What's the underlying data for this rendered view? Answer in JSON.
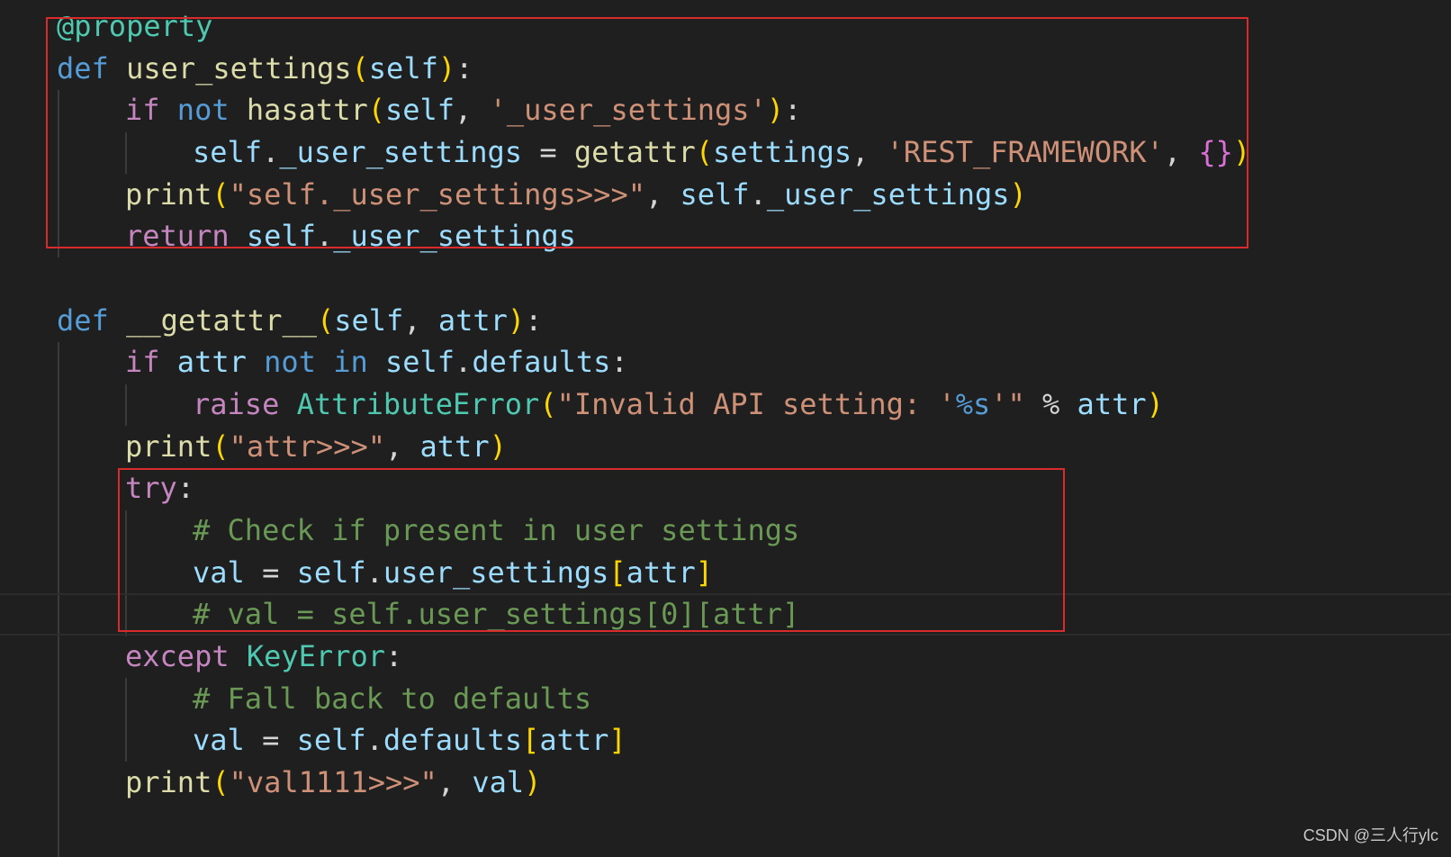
{
  "editor": {
    "lines": [
      {
        "tokens": [
          {
            "t": "@property",
            "c": "cls"
          }
        ]
      },
      {
        "tokens": [
          {
            "t": "def ",
            "c": "kw"
          },
          {
            "t": "user_settings",
            "c": "fn"
          },
          {
            "t": "(",
            "c": "br1"
          },
          {
            "t": "self",
            "c": "var"
          },
          {
            "t": ")",
            "c": "br1"
          },
          {
            "t": ":",
            "c": "op"
          }
        ]
      },
      {
        "tokens": [
          {
            "t": "if ",
            "c": "ctrl"
          },
          {
            "t": "not ",
            "c": "kw"
          },
          {
            "t": "hasattr",
            "c": "fn"
          },
          {
            "t": "(",
            "c": "br1"
          },
          {
            "t": "self",
            "c": "var"
          },
          {
            "t": ", ",
            "c": "op"
          },
          {
            "t": "'_user_settings'",
            "c": "str"
          },
          {
            "t": ")",
            "c": "br1"
          },
          {
            "t": ":",
            "c": "op"
          }
        ]
      },
      {
        "tokens": [
          {
            "t": "self",
            "c": "var"
          },
          {
            "t": ".",
            "c": "op"
          },
          {
            "t": "_user_settings",
            "c": "var"
          },
          {
            "t": " = ",
            "c": "op"
          },
          {
            "t": "getattr",
            "c": "fn"
          },
          {
            "t": "(",
            "c": "br1"
          },
          {
            "t": "settings",
            "c": "var"
          },
          {
            "t": ", ",
            "c": "op"
          },
          {
            "t": "'REST_FRAMEWORK'",
            "c": "str"
          },
          {
            "t": ", ",
            "c": "op"
          },
          {
            "t": "{}",
            "c": "br2"
          },
          {
            "t": ")",
            "c": "br1"
          }
        ]
      },
      {
        "tokens": [
          {
            "t": "print",
            "c": "fn"
          },
          {
            "t": "(",
            "c": "br1"
          },
          {
            "t": "\"self._user_settings>>>\"",
            "c": "str"
          },
          {
            "t": ", ",
            "c": "op"
          },
          {
            "t": "self",
            "c": "var"
          },
          {
            "t": ".",
            "c": "op"
          },
          {
            "t": "_user_settings",
            "c": "var"
          },
          {
            "t": ")",
            "c": "br1"
          }
        ]
      },
      {
        "tokens": [
          {
            "t": "return ",
            "c": "ctrl"
          },
          {
            "t": "self",
            "c": "var"
          },
          {
            "t": ".",
            "c": "op"
          },
          {
            "t": "_user_settings",
            "c": "var"
          }
        ]
      },
      {
        "tokens": [
          {
            "t": "def ",
            "c": "kw"
          },
          {
            "t": "__getattr__",
            "c": "fn"
          },
          {
            "t": "(",
            "c": "br1"
          },
          {
            "t": "self",
            "c": "var"
          },
          {
            "t": ", ",
            "c": "op"
          },
          {
            "t": "attr",
            "c": "var"
          },
          {
            "t": ")",
            "c": "br1"
          },
          {
            "t": ":",
            "c": "op"
          }
        ]
      },
      {
        "tokens": [
          {
            "t": "if ",
            "c": "ctrl"
          },
          {
            "t": "attr ",
            "c": "var"
          },
          {
            "t": "not ",
            "c": "kw"
          },
          {
            "t": "in ",
            "c": "kw"
          },
          {
            "t": "self",
            "c": "var"
          },
          {
            "t": ".",
            "c": "op"
          },
          {
            "t": "defaults",
            "c": "var"
          },
          {
            "t": ":",
            "c": "op"
          }
        ]
      },
      {
        "tokens": [
          {
            "t": "raise ",
            "c": "ctrl"
          },
          {
            "t": "AttributeError",
            "c": "cls"
          },
          {
            "t": "(",
            "c": "br1"
          },
          {
            "t": "\"Invalid API setting: '",
            "c": "str"
          },
          {
            "t": "%s",
            "c": "fmt"
          },
          {
            "t": "'\"",
            "c": "str"
          },
          {
            "t": " % ",
            "c": "op"
          },
          {
            "t": "attr",
            "c": "var"
          },
          {
            "t": ")",
            "c": "br1"
          }
        ]
      },
      {
        "tokens": [
          {
            "t": "print",
            "c": "fn"
          },
          {
            "t": "(",
            "c": "br1"
          },
          {
            "t": "\"attr>>>\"",
            "c": "str"
          },
          {
            "t": ", ",
            "c": "op"
          },
          {
            "t": "attr",
            "c": "var"
          },
          {
            "t": ")",
            "c": "br1"
          }
        ]
      },
      {
        "tokens": [
          {
            "t": "try",
            "c": "ctrl"
          },
          {
            "t": ":",
            "c": "op"
          }
        ]
      },
      {
        "tokens": [
          {
            "t": "# Check if present in user settings",
            "c": "cmt"
          }
        ]
      },
      {
        "tokens": [
          {
            "t": "val",
            "c": "var"
          },
          {
            "t": " = ",
            "c": "op"
          },
          {
            "t": "self",
            "c": "var"
          },
          {
            "t": ".",
            "c": "op"
          },
          {
            "t": "user_settings",
            "c": "var"
          },
          {
            "t": "[",
            "c": "br1"
          },
          {
            "t": "attr",
            "c": "var"
          },
          {
            "t": "]",
            "c": "br1"
          }
        ]
      },
      {
        "tokens": [
          {
            "t": "# val = self.user_settings[0][attr]",
            "c": "cmt"
          }
        ]
      },
      {
        "tokens": [
          {
            "t": "except ",
            "c": "ctrl"
          },
          {
            "t": "KeyError",
            "c": "cls"
          },
          {
            "t": ":",
            "c": "op"
          }
        ]
      },
      {
        "tokens": [
          {
            "t": "# Fall back to defaults",
            "c": "cmt"
          }
        ]
      },
      {
        "tokens": [
          {
            "t": "val",
            "c": "var"
          },
          {
            "t": " = ",
            "c": "op"
          },
          {
            "t": "self",
            "c": "var"
          },
          {
            "t": ".",
            "c": "op"
          },
          {
            "t": "defaults",
            "c": "var"
          },
          {
            "t": "[",
            "c": "br1"
          },
          {
            "t": "attr",
            "c": "var"
          },
          {
            "t": "]",
            "c": "br1"
          }
        ]
      },
      {
        "tokens": [
          {
            "t": "print",
            "c": "fn"
          },
          {
            "t": "(",
            "c": "br1"
          },
          {
            "t": "\"val1111>>>\"",
            "c": "str"
          },
          {
            "t": ", ",
            "c": "op"
          },
          {
            "t": "val",
            "c": "var"
          },
          {
            "t": ")",
            "c": "br1"
          }
        ]
      }
    ]
  },
  "watermark": "CSDN @三人行ylc",
  "colors": {
    "background": "#1f1f1f",
    "keyword": "#569cd6",
    "control": "#c586c0",
    "function": "#dcdcaa",
    "variable": "#9cdcfe",
    "string": "#ce9178",
    "class": "#4ec9b0",
    "comment": "#6a9955",
    "bracket_gold": "#ffd700",
    "bracket_orchid": "#da70d6",
    "highlight_box": "#d92b2b"
  }
}
